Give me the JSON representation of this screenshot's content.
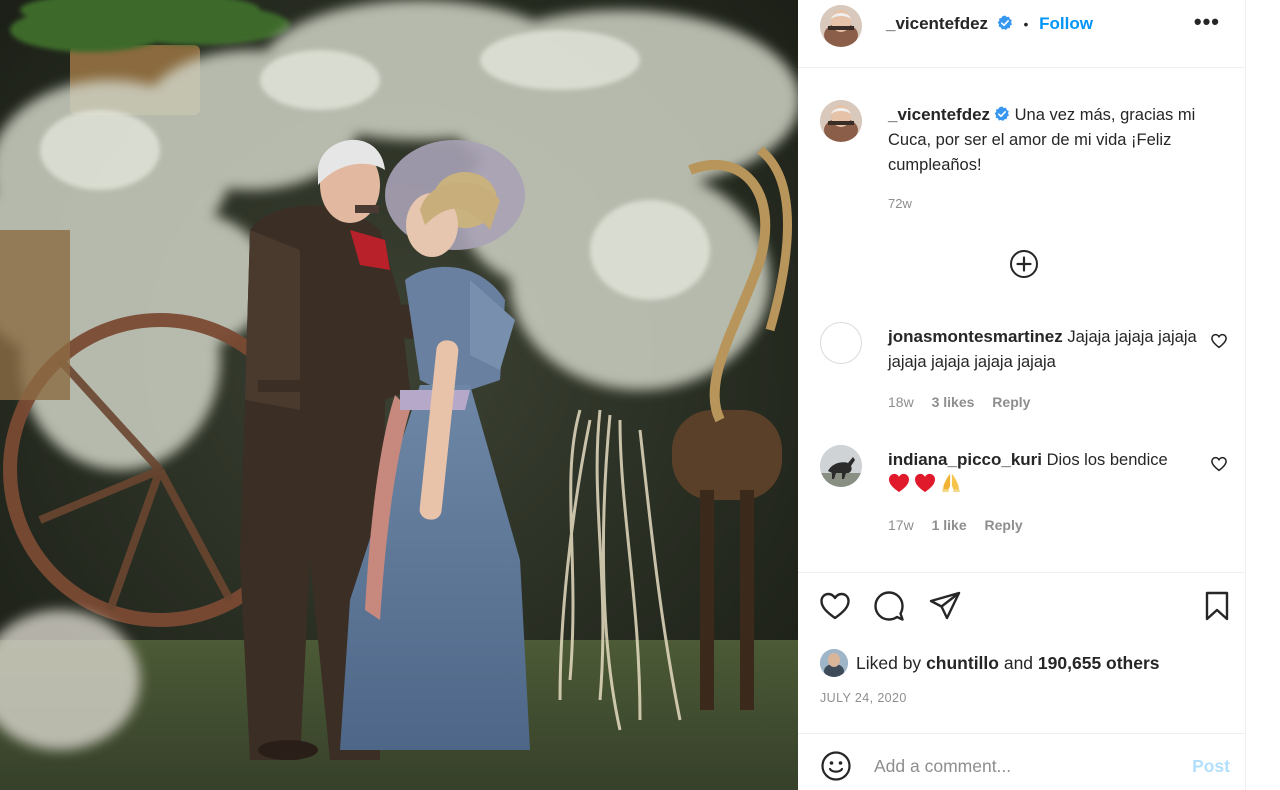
{
  "post": {
    "username": "_vicentefdez",
    "follow_label": "Follow",
    "dot": "•",
    "more_label": "•••",
    "caption": "Una vez más, gracias mi Cuca, por ser el amor de mi vida ¡Feliz cumpleaños!",
    "caption_age": "72w",
    "likes_prefix": "Liked by",
    "likes_user": "chuntillo",
    "likes_and": "and",
    "likes_count": "190,655 others",
    "date": "JULY 24, 2020"
  },
  "comments": [
    {
      "username": "jonasmontesmartinez",
      "text": "Jajaja jajaja jajaja jajaja jajaja jajaja jajaja",
      "age": "18w",
      "likes": "3 likes",
      "reply": "Reply"
    },
    {
      "username": "indiana_picco_kuri",
      "text": "Dios los bendice",
      "age": "17w",
      "likes": "1 like",
      "reply": "Reply"
    }
  ],
  "add_comment": {
    "placeholder": "Add a comment...",
    "post_label": "Post"
  },
  "icons": {
    "verified": "verified-badge-icon",
    "load_more": "plus-circle-icon",
    "like": "heart-outline-icon",
    "comment": "comment-bubble-icon",
    "share": "paper-plane-icon",
    "save": "bookmark-icon",
    "emoji": "smiley-icon",
    "comment_emojis": [
      "red-heart-emoji",
      "red-heart-emoji",
      "praying-hands-emoji"
    ]
  },
  "colors": {
    "link_blue": "#0095f6",
    "post_disabled": "#b2dffc",
    "secondary_text": "#8e8e8e",
    "divider": "#efefef"
  }
}
